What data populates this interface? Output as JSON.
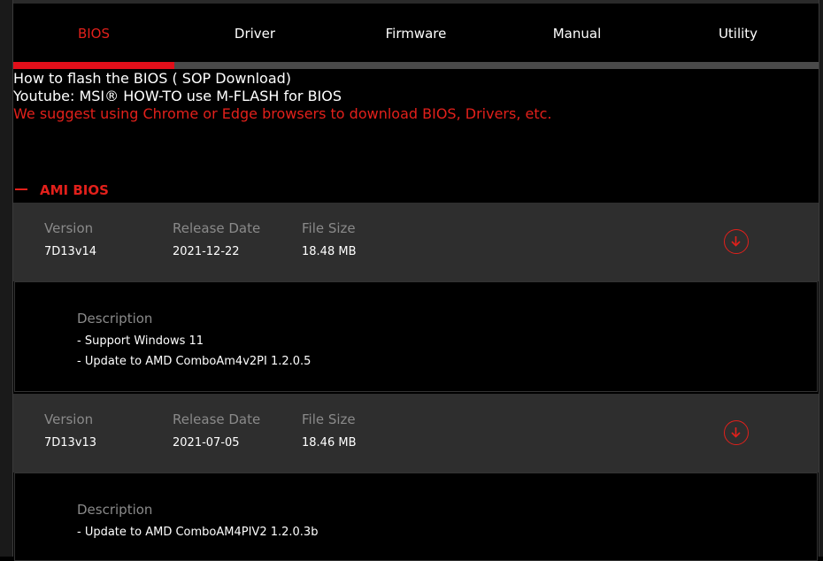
{
  "tabs": [
    "BIOS",
    "Driver",
    "Firmware",
    "Manual",
    "Utility"
  ],
  "active_tab": "BIOS",
  "info": {
    "flash_link": "How to flash the BIOS ( SOP Download)",
    "youtube_link": "Youtube: MSI® HOW-TO use M-FLASH for BIOS",
    "browser_notice": "We suggest using Chrome or Edge browsers to download BIOS, Drivers, etc."
  },
  "section": {
    "title": "AMI BIOS"
  },
  "labels": {
    "version": "Version",
    "release_date": "Release Date",
    "file_size": "File Size",
    "description": "Description"
  },
  "bios": [
    {
      "version": "7D13v14",
      "release_date": "2021-12-22",
      "file_size": "18.48 MB",
      "description": [
        "- Support Windows 11",
        "- Update to AMD ComboAm4v2PI 1.2.0.5"
      ]
    },
    {
      "version": "7D13v13",
      "release_date": "2021-07-05",
      "file_size": "18.46 MB",
      "description": [
        "- Update to AMD ComboAM4PIV2 1.2.0.3b"
      ]
    }
  ],
  "colors": {
    "accent": "#e2201b",
    "row_bg": "#2e2e2e",
    "label_gray": "#8a8a8a"
  },
  "icons": {
    "download": "download-circle-icon",
    "collapse": "minus-icon"
  }
}
